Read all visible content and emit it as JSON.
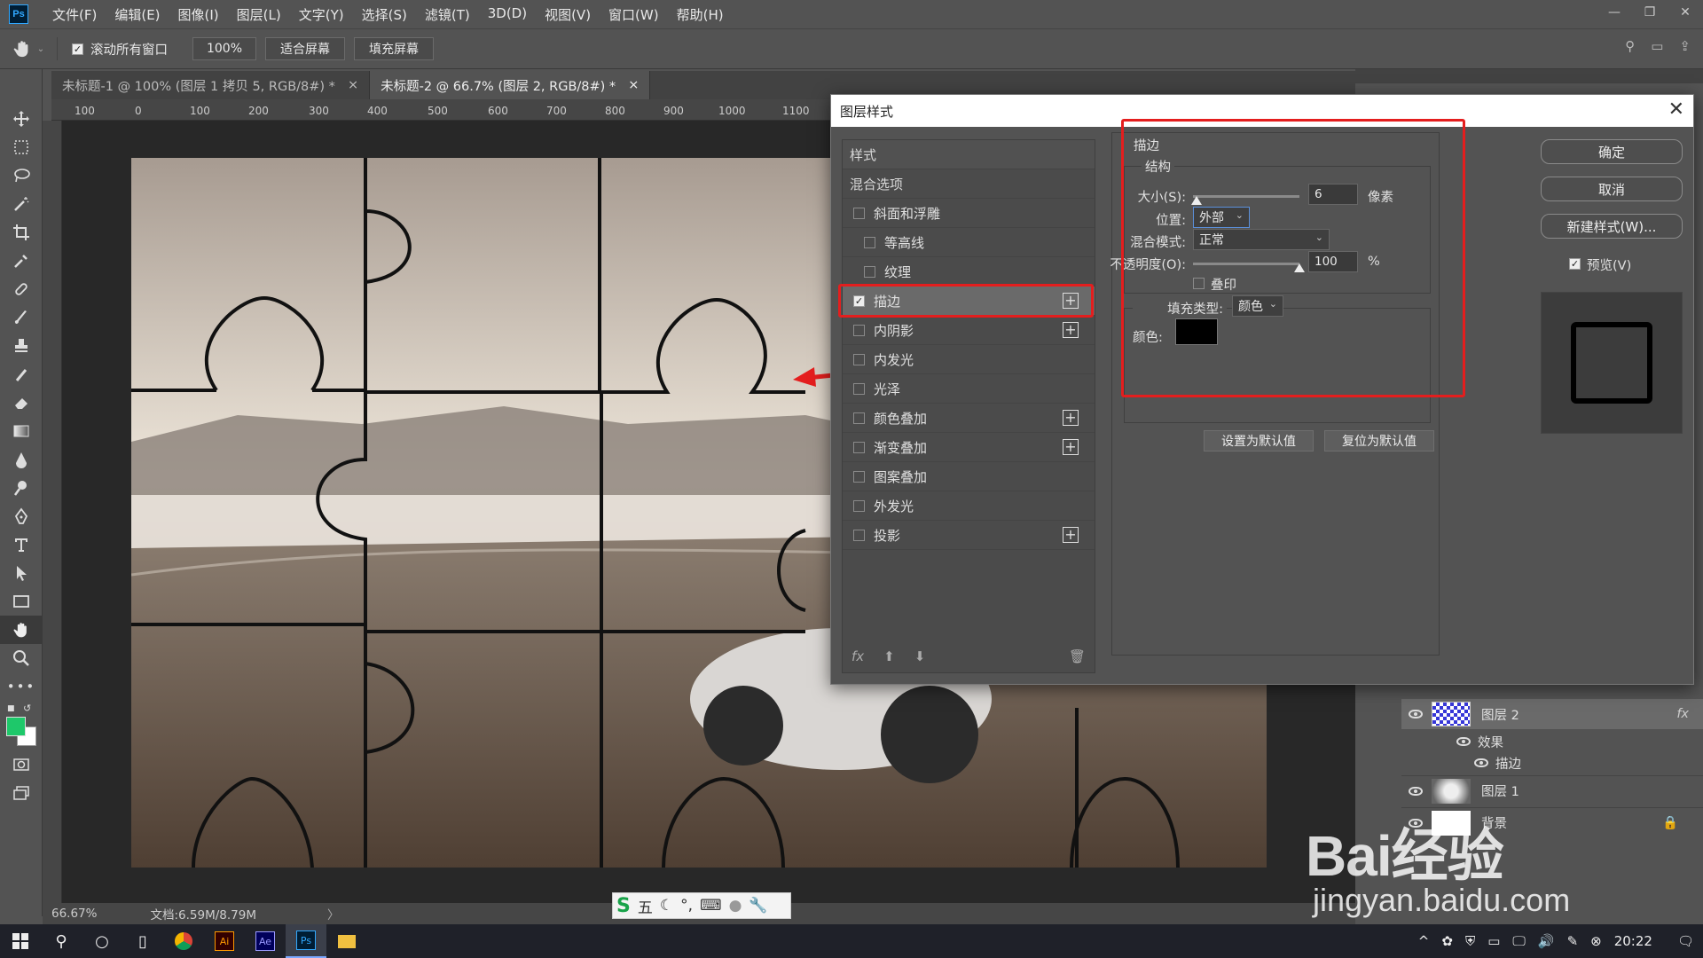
{
  "app": {
    "logo": "Ps"
  },
  "menu": [
    "文件(F)",
    "编辑(E)",
    "图像(I)",
    "图层(L)",
    "文字(Y)",
    "选择(S)",
    "滤镜(T)",
    "3D(D)",
    "视图(V)",
    "窗口(W)",
    "帮助(H)"
  ],
  "window_controls": {
    "minimize": "—",
    "restore": "❐",
    "close": "✕"
  },
  "options": {
    "scroll_all_label": "滚动所有窗口",
    "zoom": "100%",
    "fit_screen": "适合屏幕",
    "fill_screen": "填充屏幕"
  },
  "tabs": [
    {
      "label": "未标题-1 @ 100% (图层 1 拷贝 5, RGB/8#) *",
      "close": "×"
    },
    {
      "label": "未标题-2 @ 66.7% (图层 2, RGB/8#) *",
      "close": "×"
    }
  ],
  "ruler": [
    "100",
    "0",
    "100",
    "200",
    "300",
    "400",
    "500",
    "600",
    "700",
    "800",
    "900",
    "1000",
    "1100"
  ],
  "status": {
    "zoom": "66.67%",
    "doc": "文档:6.59M/8.79M"
  },
  "dialog": {
    "title": "图层样式",
    "close": "✕",
    "list": {
      "header": "样式",
      "blend": "混合选项",
      "items": [
        {
          "label": "斜面和浮雕",
          "checked": false,
          "plus": false,
          "indent": false
        },
        {
          "label": "等高线",
          "checked": false,
          "plus": false,
          "indent": true
        },
        {
          "label": "纹理",
          "checked": false,
          "plus": false,
          "indent": true
        },
        {
          "label": "描边",
          "checked": true,
          "plus": true,
          "indent": false
        },
        {
          "label": "内阴影",
          "checked": false,
          "plus": true,
          "indent": false
        },
        {
          "label": "内发光",
          "checked": false,
          "plus": false,
          "indent": false
        },
        {
          "label": "光泽",
          "checked": false,
          "plus": false,
          "indent": false
        },
        {
          "label": "颜色叠加",
          "checked": false,
          "plus": true,
          "indent": false
        },
        {
          "label": "渐变叠加",
          "checked": false,
          "plus": true,
          "indent": false
        },
        {
          "label": "图案叠加",
          "checked": false,
          "plus": false,
          "indent": false
        },
        {
          "label": "外发光",
          "checked": false,
          "plus": false,
          "indent": false
        },
        {
          "label": "投影",
          "checked": false,
          "plus": true,
          "indent": false
        }
      ],
      "fx": "fx"
    },
    "stroke": {
      "section": "描边",
      "structure": "结构",
      "size_label": "大小(S):",
      "size_value": "6",
      "size_unit": "像素",
      "position_label": "位置:",
      "position_value": "外部",
      "blend_label": "混合模式:",
      "blend_value": "正常",
      "opacity_label": "不透明度(O):",
      "opacity_value": "100",
      "opacity_unit": "%",
      "opacity_level": 1.0,
      "size_level": 0.03,
      "overprint_label": "叠印",
      "fill_type_label": "填充类型:",
      "fill_type_value": "颜色",
      "color_label": "颜色:",
      "color_value": "#000000"
    },
    "set_default": "设置为默认值",
    "reset_default": "复位为默认值",
    "ok": "确定",
    "cancel": "取消",
    "new_style": "新建样式(W)...",
    "preview_label": "预览(V)"
  },
  "layers": [
    {
      "name": "图层 2",
      "fx": "fx"
    },
    {
      "name": "效果"
    },
    {
      "name": "描边"
    },
    {
      "name": "图层 1"
    },
    {
      "name": "背景"
    }
  ],
  "ime": {
    "label": "五"
  },
  "watermark": {
    "brand": "Bai经验",
    "url": "jingyan.baidu.com"
  },
  "taskbar": {
    "time": "20:22",
    "apps": [
      "Ai",
      "Ae",
      "Ps"
    ]
  },
  "colors": {
    "accent_red": "#e41e1e",
    "fg_swatch": "#1ec86a",
    "ps_blue": "#31a8ff"
  }
}
